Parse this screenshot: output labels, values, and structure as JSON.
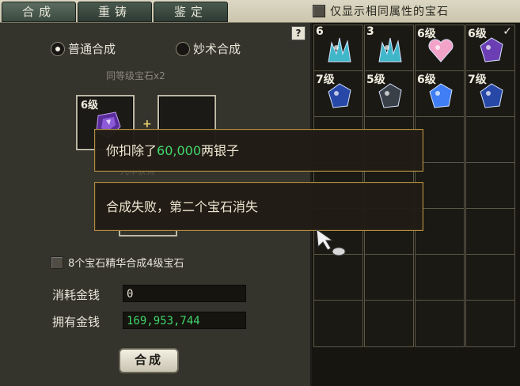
{
  "tabs": [
    {
      "label": "合成"
    },
    {
      "label": "重铸"
    },
    {
      "label": "鉴定"
    }
  ],
  "filter": {
    "label": "仅显示相同属性的宝石"
  },
  "help_label": "?",
  "modes": {
    "normal": "普通合成",
    "magic": "妙术合成",
    "selected": "normal"
  },
  "subtitle": "同等级宝石x2",
  "slot1": {
    "level": "6级"
  },
  "plus": "+",
  "slot2_tag": "几率获得",
  "essence_label": "8个宝石精华合成4级宝石",
  "cost": {
    "label": "消耗金钱",
    "value": "0"
  },
  "owned": {
    "label": "拥有金钱",
    "value": "169,953,744"
  },
  "compose_button": "合成",
  "popup1": {
    "prefix": "你扣除了",
    "amount": "60,000",
    "suffix": "两银子"
  },
  "popup2": {
    "text": "合成失败，第二个宝石消失"
  },
  "inventory": [
    {
      "level": "6",
      "gem": "teal-crystal-icon",
      "color": "#3fb7c9"
    },
    {
      "level": "3",
      "gem": "teal-crystal-icon",
      "color": "#3fb7c9"
    },
    {
      "level": "6级",
      "gem": "pink-heart-gem-icon",
      "color": "#f3a2c8"
    },
    {
      "level": "6级",
      "gem": "purple-gem-icon",
      "color": "#6b3fb3",
      "checked": "✓"
    },
    {
      "level": "7级",
      "gem": "blue-gem-icon",
      "color": "#2848a8"
    },
    {
      "level": "5级",
      "gem": "dark-gem-icon",
      "color": "#3a4048"
    },
    {
      "level": "6级",
      "gem": "bright-blue-gem-icon",
      "color": "#3f7ef5"
    },
    {
      "level": "7级",
      "gem": "blue-gem-icon",
      "color": "#2848a8"
    }
  ],
  "colors": {
    "money_green": "#41d66a",
    "popup_border": "#b08d43"
  }
}
